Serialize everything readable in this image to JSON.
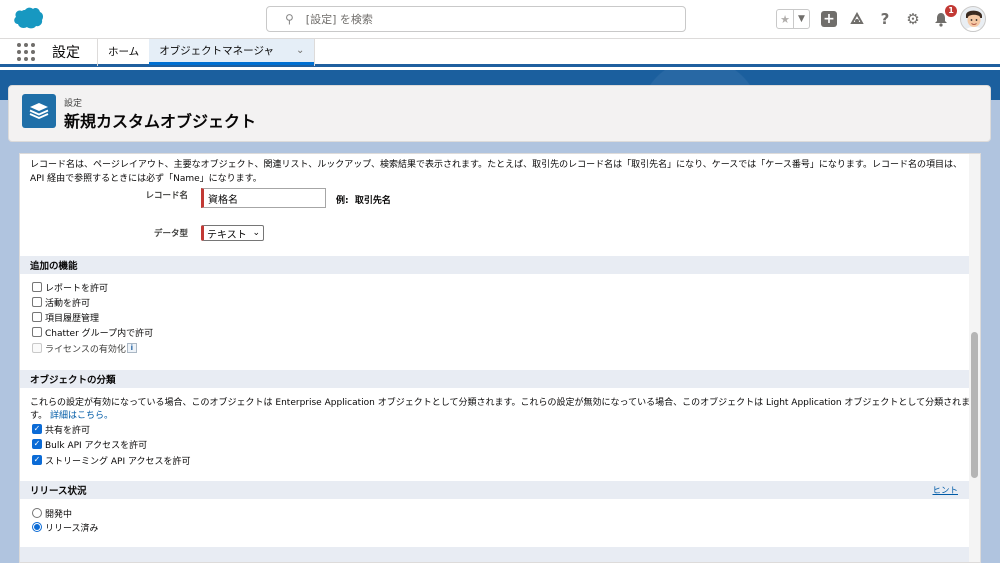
{
  "header": {
    "search_placeholder": "[設定] を検索",
    "notification_count": "1",
    "icons": [
      "salesforce-cloud-logo",
      "star-icon",
      "chevron-down-icon",
      "plus-icon",
      "cloud-icon",
      "help-icon",
      "gear-icon",
      "bell-icon",
      "avatar"
    ]
  },
  "nav": {
    "app_name": "設定",
    "tabs": [
      {
        "label": "ホーム"
      },
      {
        "label": "オブジェクトマネージャ"
      }
    ]
  },
  "page_header": {
    "breadcrumb": "設定",
    "title": "新規カスタムオブジェクト"
  },
  "form": {
    "record_name_description": "レコード名は、ページレイアウト、主要なオブジェクト、関連リスト、ルックアップ、検索結果で表示されます。たとえば、取引先のレコード名は「取引先名」になり、ケースでは「ケース番号」になります。レコード名の項目は、API 経由で参照するときには必ず「Name」になります。",
    "record_name_label": "レコード名",
    "record_name_value": "資格名",
    "example_label": "例:",
    "example_value": "取引先名",
    "data_type_label": "データ型",
    "data_type_value": "テキスト"
  },
  "sections": {
    "optional_features": {
      "title": "追加の機能",
      "options": [
        {
          "label": "レポートを許可",
          "checked": false
        },
        {
          "label": "活動を許可",
          "checked": false
        },
        {
          "label": "項目履歴管理",
          "checked": false
        },
        {
          "label": "Chatter グループ内で許可",
          "checked": false
        },
        {
          "label": "ライセンスの有効化",
          "checked": false,
          "disabled": true
        }
      ]
    },
    "classification": {
      "title": "オブジェクトの分類",
      "description": "これらの設定が有効になっている場合、このオブジェクトは Enterprise Application オブジェクトとして分類されます。これらの設定が無効になっている場合、このオブジェクトは Light Application オブジェクトとして分類されます。",
      "link": "詳細はこちら。",
      "options": [
        {
          "label": "共有を許可",
          "checked": true
        },
        {
          "label": "Bulk API アクセスを許可",
          "checked": true
        },
        {
          "label": "ストリーミング API アクセスを許可",
          "checked": true
        }
      ]
    },
    "deployment_status": {
      "title": "リリース状況",
      "hint": "ヒント",
      "options": [
        {
          "label": "開発中",
          "selected": false
        },
        {
          "label": "リリース済み",
          "selected": true
        }
      ]
    }
  },
  "colors": {
    "brand_blue": "#1b5f9e",
    "required_red": "#c23934",
    "checkbox_blue": "#0b6bd6",
    "section_bg": "#e8ecf3"
  }
}
